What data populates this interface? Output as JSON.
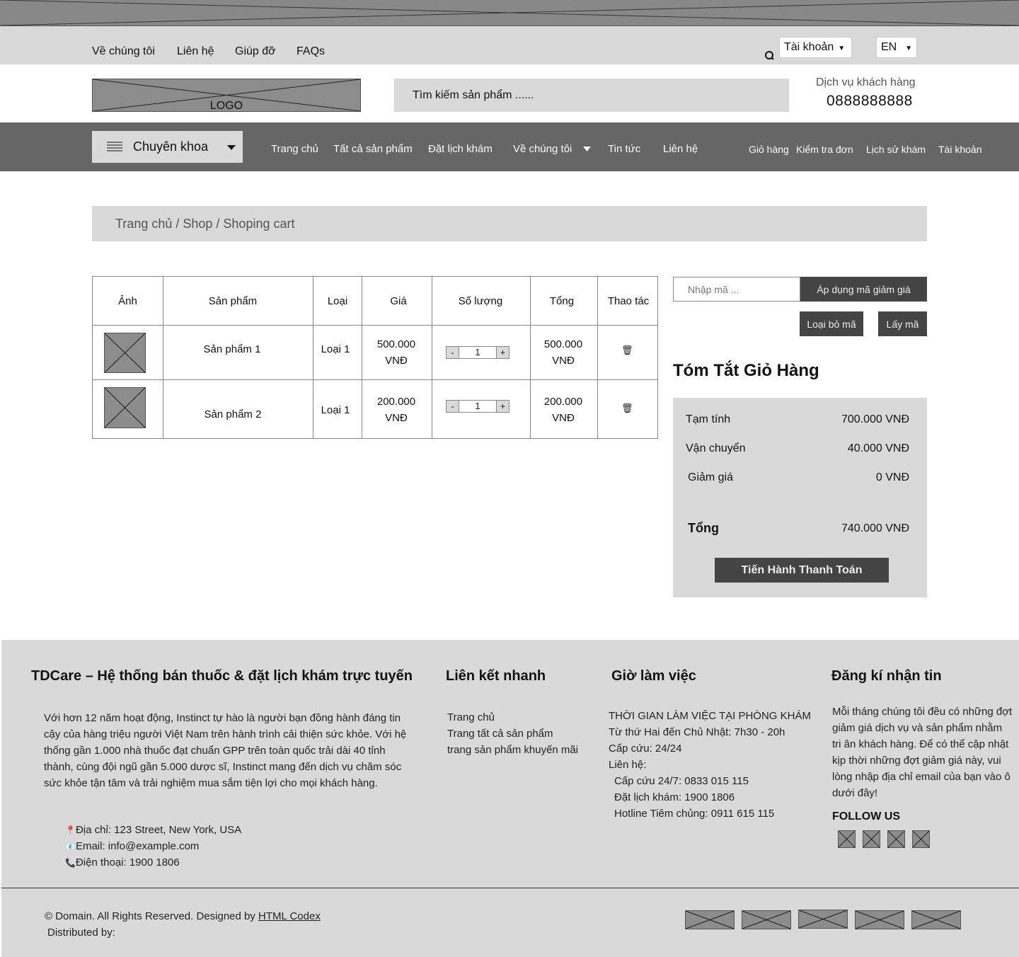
{
  "topbar": {
    "links": [
      "Về chúng tôi",
      "Liên hệ",
      "Giúp đỡ",
      "FAQs"
    ],
    "account_select": "Tài khoản",
    "language_select": "EN"
  },
  "header": {
    "logo_label": "LOGO",
    "search_placeholder": "Tìm kiếm sản phẩm ......",
    "customer_service_label": "Dịch vụ khách hàng",
    "customer_service_phone": "0888888888"
  },
  "nav": {
    "category_label": "Chuyên khoa",
    "links": [
      "Trang chủ",
      "Tất cả sản phẩm",
      "Đặt lịch khám",
      "Về chúng tôi",
      "Tin tức",
      "Liên hệ"
    ],
    "right_links": [
      "Giỏ hàng",
      "Kiểm tra đơn",
      "Lịch sử khám",
      "Tài khoản"
    ]
  },
  "breadcrumb": "Trang chủ / Shop / Shoping cart",
  "cart": {
    "headers": [
      "Ảnh",
      "Sản phẩm",
      "Loại",
      "Giá",
      "Số lượng",
      "Tổng",
      "Thao tác"
    ],
    "rows": [
      {
        "product": "Sản phẩm 1",
        "type": "Loại 1",
        "price": "500.000 VNĐ",
        "qty": "1",
        "total": "500.000 VNĐ"
      },
      {
        "product": "Sản phẩm 2",
        "type": "Loại 1",
        "price": "200.000 VNĐ",
        "qty": "1",
        "total": "200.000 VNĐ"
      }
    ],
    "minus": "-",
    "plus": "+"
  },
  "coupon": {
    "placeholder": "Nhập mã ...",
    "apply": "Áp dụng mã giảm giá",
    "remove": "Loại bỏ mã",
    "get": "Lấy mã"
  },
  "summary": {
    "title": "Tóm Tắt Giỏ Hàng",
    "subtotal_label": "Tạm tính",
    "subtotal": "700.000 VNĐ",
    "shipping_label": "Vận chuyển",
    "shipping": "40.000 VNĐ",
    "discount_label": "Giảm giá",
    "discount": "0 VNĐ",
    "total_label": "Tổng",
    "total": "740.000 VNĐ",
    "checkout": "Tiến Hành Thanh Toán"
  },
  "footer": {
    "about_title": "TDCare – Hệ thống bán thuốc & đặt lịch khám trực tuyến",
    "about_text": "Với hơn 12 năm hoạt động, Instinct tự hào là người bạn đồng hành đáng tin cậy của hàng triệu người Việt Nam trên hành trình cải thiện sức khỏe. Với hệ thống gần 1.000 nhà thuốc đạt chuẩn GPP trên toàn quốc trải dài 40 tỉnh thành, cùng đội ngũ gần 5.000 dược sĩ, Instinct mang đến dịch vụ chăm sóc sức khỏe tận tâm và trải nghiệm mua sắm tiện lợi cho mọi khách hàng.",
    "address": "Địa chỉ: 123 Street, New York, USA",
    "email": "Email: info@example.com",
    "phone": "Điện thoại: 1900 1806",
    "quick_title": "Liên kết nhanh",
    "quick_links": [
      "Trang chủ",
      "Trang tất cả sản phẩm",
      "trang sản phẩm khuyến mãi"
    ],
    "hours_title": "Giờ làm việc",
    "hours_lines": [
      "THỜI GIAN LÀM VIỆC TẠI PHÒNG KHÁM",
      "Từ thứ Hai đến Chủ Nhật: 7h30 - 20h",
      "Cấp cứu: 24/24",
      "Liên hệ:"
    ],
    "hours_contacts": [
      "Cấp cứu 24/7: 0833 015 115",
      "Đặt lịch khám: 1900 1806",
      "Hotline Tiêm chủng: 0911 615 115"
    ],
    "newsletter_title": "Đăng kí nhận tin",
    "newsletter_text": "Mỗi tháng chúng tôi đều có những đợt giảm giá dịch vụ và sản phẩm nhằm tri ân khách hàng. Để có thể cập nhật kịp thời những đợt giảm giá này, vui lòng nhập địa chỉ email của bạn vào ô dưới đây!",
    "follow": "FOLLOW US",
    "copyright": "© Domain. All Rights Reserved. Designed by",
    "designer": "HTML Codex",
    "distributed": "Distributed by:"
  },
  "icons": {
    "pin": "📍",
    "mail": "📧",
    "phone": "📞",
    "trash": "🗑",
    "search": "search-icon",
    "menu": "menu-icon"
  },
  "colors": {
    "dark": "#444444",
    "nav": "#666666",
    "panel": "#d9d9d9",
    "placeholder": "#8c8c8c"
  }
}
